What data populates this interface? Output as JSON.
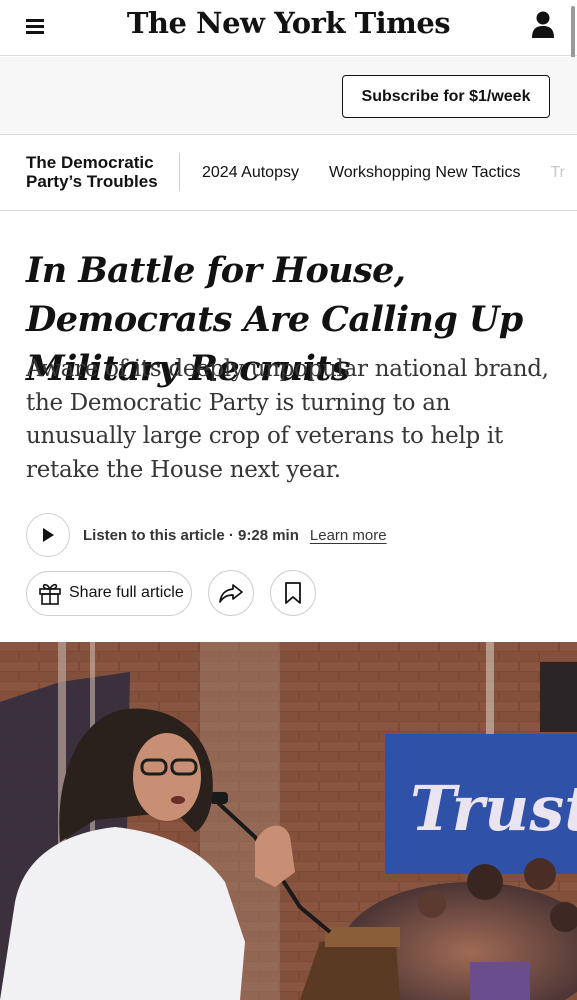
{
  "masthead": {
    "logo": "The New York Times",
    "menu_icon": "hamburger-menu-icon",
    "account_icon": "user-account-icon"
  },
  "subscribe": {
    "label": "Subscribe for $1/week"
  },
  "section_nav": {
    "title": "The Democratic Party’s Troubles",
    "links": [
      "2024 Autopsy",
      "Workshopping New Tactics",
      "Tr"
    ]
  },
  "article": {
    "headline": "In Battle for House, Democrats Are Calling Up Military Recruits",
    "summary": "Aware of its deeply unpopular national brand, the Democratic Party is turning to an unusually large crop of veterans to help it retake the House next year.",
    "audio": {
      "label": "Listen to this article · 9:28 min",
      "learn_more": "Learn more"
    },
    "share": {
      "label": "Share full article",
      "icons": [
        "gift-icon",
        "share-arrow-icon",
        "bookmark-icon"
      ]
    },
    "photo": {
      "sign_text": "Trust"
    }
  },
  "colors": {
    "text": "#121212",
    "muted_text": "#363636",
    "border": "#dcdcdc",
    "banner_blue": "#2f51a8",
    "brick": "#7a4a36"
  }
}
